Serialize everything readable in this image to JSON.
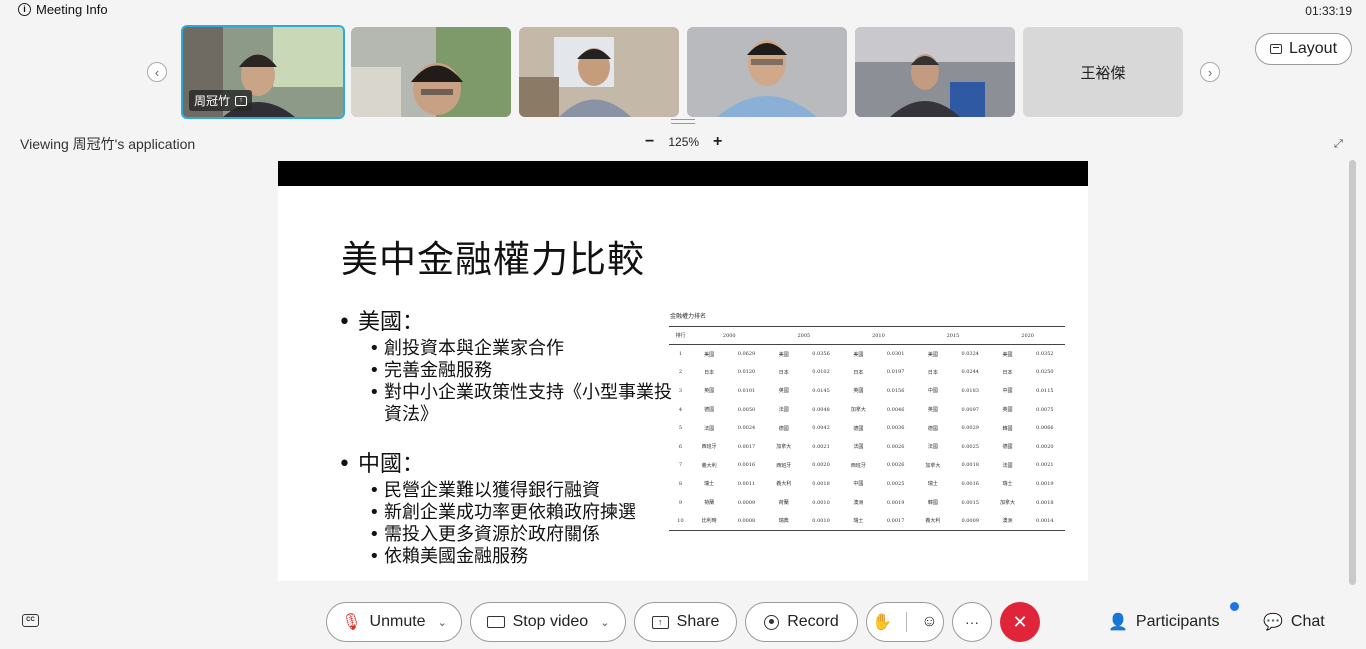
{
  "topbar": {
    "meeting_info_label": "Meeting Info",
    "clock": "01:33:19",
    "layout_label": "Layout"
  },
  "filmstrip": {
    "participants": [
      {
        "name": "周冠竹",
        "active": true,
        "sharing": true,
        "bg": "#7f8a7d"
      },
      {
        "name": "",
        "active": false,
        "sharing": false,
        "bg": "#9aa696"
      },
      {
        "name": "",
        "active": false,
        "sharing": false,
        "bg": "#a59a8d"
      },
      {
        "name": "",
        "active": false,
        "sharing": false,
        "bg": "#b9b9bb"
      },
      {
        "name": "",
        "active": false,
        "sharing": false,
        "bg": "#7d7f88"
      },
      {
        "name": "王裕傑",
        "active": false,
        "sharing": false,
        "bg": "#d8d8d8"
      }
    ]
  },
  "viewer": {
    "viewing_text": "Viewing 周冠竹's application",
    "zoom_level": "125%",
    "zoom_out": "−",
    "zoom_in": "+"
  },
  "slide": {
    "title": "美中金融權力比較",
    "sections": [
      {
        "heading": "美國：",
        "items": [
          "創投資本與企業家合作",
          "完善金融服務",
          "對中小企業政策性支持《小型事業投資法》"
        ]
      },
      {
        "heading": "中國：",
        "items": [
          "民營企業難以獲得銀行融資",
          "新創企業成功率更依賴政府揀選",
          "需投入更多資源於政府關係",
          "依賴美國金融服務"
        ]
      }
    ],
    "table": {
      "caption": "金融權力排名",
      "headers": [
        "排行",
        "2000",
        "",
        "2005",
        "",
        "2010",
        "",
        "2015",
        "",
        "2020",
        ""
      ],
      "rows": [
        [
          "1",
          "美國",
          "0.0629",
          "美國",
          "0.0356",
          "美國",
          "0.0301",
          "美國",
          "0.0324",
          "美國",
          "0.0352"
        ],
        [
          "2",
          "日本",
          "0.0120",
          "日本",
          "0.0102",
          "日本",
          "0.0197",
          "日本",
          "0.0244",
          "日本",
          "0.0250"
        ],
        [
          "3",
          "英國",
          "0.0101",
          "英國",
          "0.0145",
          "英國",
          "0.0156",
          "中國",
          "0.0183",
          "中國",
          "0.0115"
        ],
        [
          "4",
          "德國",
          "0.0050",
          "法國",
          "0.0048",
          "加拿大",
          "0.0046",
          "英國",
          "0.0097",
          "英國",
          "0.0075"
        ],
        [
          "5",
          "法國",
          "0.0024",
          "德國",
          "0.0042",
          "德國",
          "0.0036",
          "德國",
          "0.0029",
          "韓國",
          "0.0066"
        ],
        [
          "6",
          "西班牙",
          "0.0017",
          "加拿大",
          "0.0021",
          "法國",
          "0.0026",
          "法國",
          "0.0025",
          "德國",
          "0.0020"
        ],
        [
          "7",
          "義大利",
          "0.0016",
          "西班牙",
          "0.0020",
          "西班牙",
          "0.0026",
          "加拿大",
          "0.0018",
          "法國",
          "0.0021"
        ],
        [
          "8",
          "瑞士",
          "0.0011",
          "義大利",
          "0.0018",
          "中國",
          "0.0025",
          "瑞士",
          "0.0016",
          "瑞士",
          "0.0019"
        ],
        [
          "9",
          "荷蘭",
          "0.0009",
          "荷蘭",
          "0.0010",
          "澳洲",
          "0.0019",
          "韓國",
          "0.0015",
          "加拿大",
          "0.0018"
        ],
        [
          "10",
          "比利時",
          "0.0008",
          "瑞典",
          "0.0010",
          "瑞士",
          "0.0017",
          "義大利",
          "0.0009",
          "澳洲",
          "0.0014"
        ]
      ]
    }
  },
  "controls": {
    "unmute_label": "Unmute",
    "stop_video_label": "Stop video",
    "share_label": "Share",
    "record_label": "Record",
    "more_label": "···",
    "participants_label": "Participants",
    "chat_label": "Chat",
    "end_color": "#e0253a"
  }
}
